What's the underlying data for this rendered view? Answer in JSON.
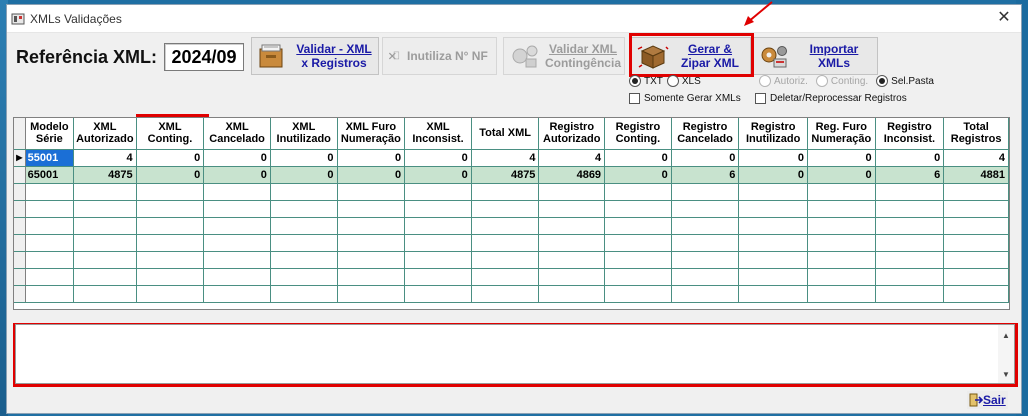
{
  "window": {
    "title": "XMLs Validações",
    "close_symbol": "✕"
  },
  "reference": {
    "label": "Referência XML:",
    "value": "2024/09"
  },
  "toolbar": {
    "validar_line1": "Validar - XML",
    "validar_line2": "x Registros",
    "inutiliza": "Inutiliza N° NF",
    "contingencia_line1": "Validar XML",
    "contingencia_line2": "Contingência",
    "gerar_line1": "Gerar  &",
    "gerar_line2": "Zipar XML",
    "importar_line1": "Importar",
    "importar_line2": "XMLs"
  },
  "options": {
    "format_txt": "TXT",
    "format_xls": "XLS",
    "autoriz": "Autoriz.",
    "conting": "Conting.",
    "sel_pasta": "Sel.Pasta",
    "somente_gerar": "Somente Gerar XMLs",
    "deletar_reprocessar": "Deletar/Reprocessar Registros"
  },
  "grid": {
    "columns": [
      [
        "Modelo",
        "Série"
      ],
      [
        "XML",
        "Autorizado"
      ],
      [
        "XML",
        "Conting."
      ],
      [
        "XML",
        "Cancelado"
      ],
      [
        "XML",
        "Inutilizado"
      ],
      [
        "XML Furo",
        "Numeração"
      ],
      [
        "XML",
        "Inconsist."
      ],
      [
        "Total XML",
        ""
      ],
      [
        "Registro",
        "Autorizado"
      ],
      [
        "Registro",
        "Conting."
      ],
      [
        "Registro",
        "Cancelado"
      ],
      [
        "Registro",
        "Inutilizado"
      ],
      [
        "Reg. Furo",
        "Numeração"
      ],
      [
        "Registro",
        "Inconsist."
      ],
      [
        "Total",
        "Registros"
      ]
    ],
    "rows": [
      [
        "55001",
        "4",
        "0",
        "0",
        "0",
        "0",
        "0",
        "4",
        "4",
        "0",
        "0",
        "0",
        "0",
        "0",
        "4"
      ],
      [
        "65001",
        "4875",
        "0",
        "0",
        "0",
        "0",
        "0",
        "4875",
        "4869",
        "0",
        "6",
        "0",
        "0",
        "6",
        "4881"
      ]
    ],
    "row_indicator": "▶"
  },
  "footer": {
    "exit_label": "Sair"
  },
  "colors": {
    "highlight_red": "#e00000",
    "selected_blue": "#1b6fd6",
    "row_green": "#c8e3cf",
    "link_blue": "#1a1aa6"
  }
}
